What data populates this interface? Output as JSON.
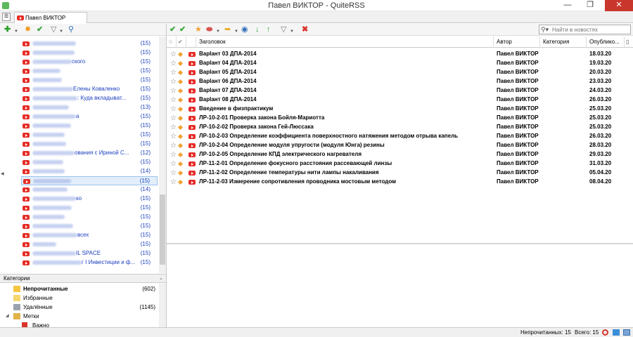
{
  "window": {
    "title": "Павел ВИКТОР - QuiteRSS"
  },
  "tab": {
    "label": "Павел ВИКТОР"
  },
  "search": {
    "placeholder": "Найти в новостях"
  },
  "feeds": [
    {
      "name": "",
      "count": "(15)"
    },
    {
      "name": "",
      "count": "(15)"
    },
    {
      "name": "ского",
      "count": "(15)"
    },
    {
      "name": "",
      "count": "(15)"
    },
    {
      "name": "",
      "count": "(15)"
    },
    {
      "name": "Елены Коваленко",
      "count": "(15)"
    },
    {
      "name": ": Куда вкладыват...",
      "count": "(15)"
    },
    {
      "name": "",
      "count": "(13)"
    },
    {
      "name": "а",
      "count": "(15)"
    },
    {
      "name": "",
      "count": "(15)"
    },
    {
      "name": "",
      "count": "(15)"
    },
    {
      "name": "",
      "count": "(15)"
    },
    {
      "name": "ования с Ириной С...",
      "count": "(12)"
    },
    {
      "name": "",
      "count": "(15)"
    },
    {
      "name": "",
      "count": "(14)"
    },
    {
      "name": "",
      "count": "(15)"
    },
    {
      "name": "",
      "count": "(14)"
    },
    {
      "name": "ко",
      "count": "(15)"
    },
    {
      "name": "",
      "count": "(15)"
    },
    {
      "name": "",
      "count": "(15)"
    },
    {
      "name": "",
      "count": "(15)"
    },
    {
      "name": "всех",
      "count": "(15)"
    },
    {
      "name": "",
      "count": "(15)"
    },
    {
      "name": "IL SPACE",
      "count": "(15)"
    },
    {
      "name": "г I Инвестиции и ф...",
      "count": "(15)"
    }
  ],
  "categories": {
    "header": "Категории",
    "items": [
      {
        "label": "Непрочитанные",
        "count": "(602)",
        "bold": true
      },
      {
        "label": "Избранные",
        "count": ""
      },
      {
        "label": "Удалённые",
        "count": "(1145)"
      },
      {
        "label": "Метки",
        "count": ""
      },
      {
        "label": "Важно",
        "count": ""
      }
    ]
  },
  "news_columns": {
    "title": "Заголовок",
    "author": "Автор",
    "category": "Категория",
    "published": "Опублико..."
  },
  "news": [
    {
      "title": "ВарІант 03 ДПА-2014",
      "author": "Павел ВИКТОР",
      "date": "18.03.20"
    },
    {
      "title": "ВарІант 04 ДПА-2014",
      "author": "Павел ВИКТОР",
      "date": "19.03.20"
    },
    {
      "title": "ВарІант 05 ДПА-2014",
      "author": "Павел ВИКТОР",
      "date": "20.03.20"
    },
    {
      "title": "ВарІант 06 ДПА-2014",
      "author": "Павел ВИКТОР",
      "date": "23.03.20"
    },
    {
      "title": "ВарІант 07 ДПА-2014",
      "author": "Павел ВИКТОР",
      "date": "24.03.20"
    },
    {
      "title": "ВарІант 08 ДПА-2014",
      "author": "Павел ВИКТОР",
      "date": "26.03.20"
    },
    {
      "title": "Введение в физпрактикум",
      "author": "Павел ВИКТОР",
      "date": "25.03.20"
    },
    {
      "title": "ЛР-10-2-01 Проверка закона Бойля-Мариотта",
      "author": "Павел ВИКТОР",
      "date": "25.03.20"
    },
    {
      "title": "ЛР-10-2-02 Проверка закона Гей-Люссака",
      "author": "Павел ВИКТОР",
      "date": "25.03.20"
    },
    {
      "title": "ЛР-10-2-03 Определение коэффициента поверхностного натяжения методом отрыва капель",
      "author": "Павел ВИКТОР",
      "date": "26.03.20"
    },
    {
      "title": "ЛР-10-2-04 Определение модуля упругости (модуля Юнга) резины",
      "author": "Павел ВИКТОР",
      "date": "28.03.20"
    },
    {
      "title": "ЛР-10-2-05 Определение КПД электрического нагревателя",
      "author": "Павел ВИКТОР",
      "date": "29.03.20"
    },
    {
      "title": "ЛР-11-2-01 Определение фокусного расстояния рассевающей линзы",
      "author": "Павел ВИКТОР",
      "date": "31.03.20"
    },
    {
      "title": "ЛР-11-2-02 Определение температуры нити лампы накаливания",
      "author": "Павел ВИКТОР",
      "date": "05.04.20"
    },
    {
      "title": "ЛР-11-2-03 Измерение сопротивления проводника мостовым методом",
      "author": "Павел ВИКТОР",
      "date": "08.04.20"
    }
  ],
  "status": {
    "unread": "Непрочитанных: 15",
    "total": "Всего: 15"
  }
}
